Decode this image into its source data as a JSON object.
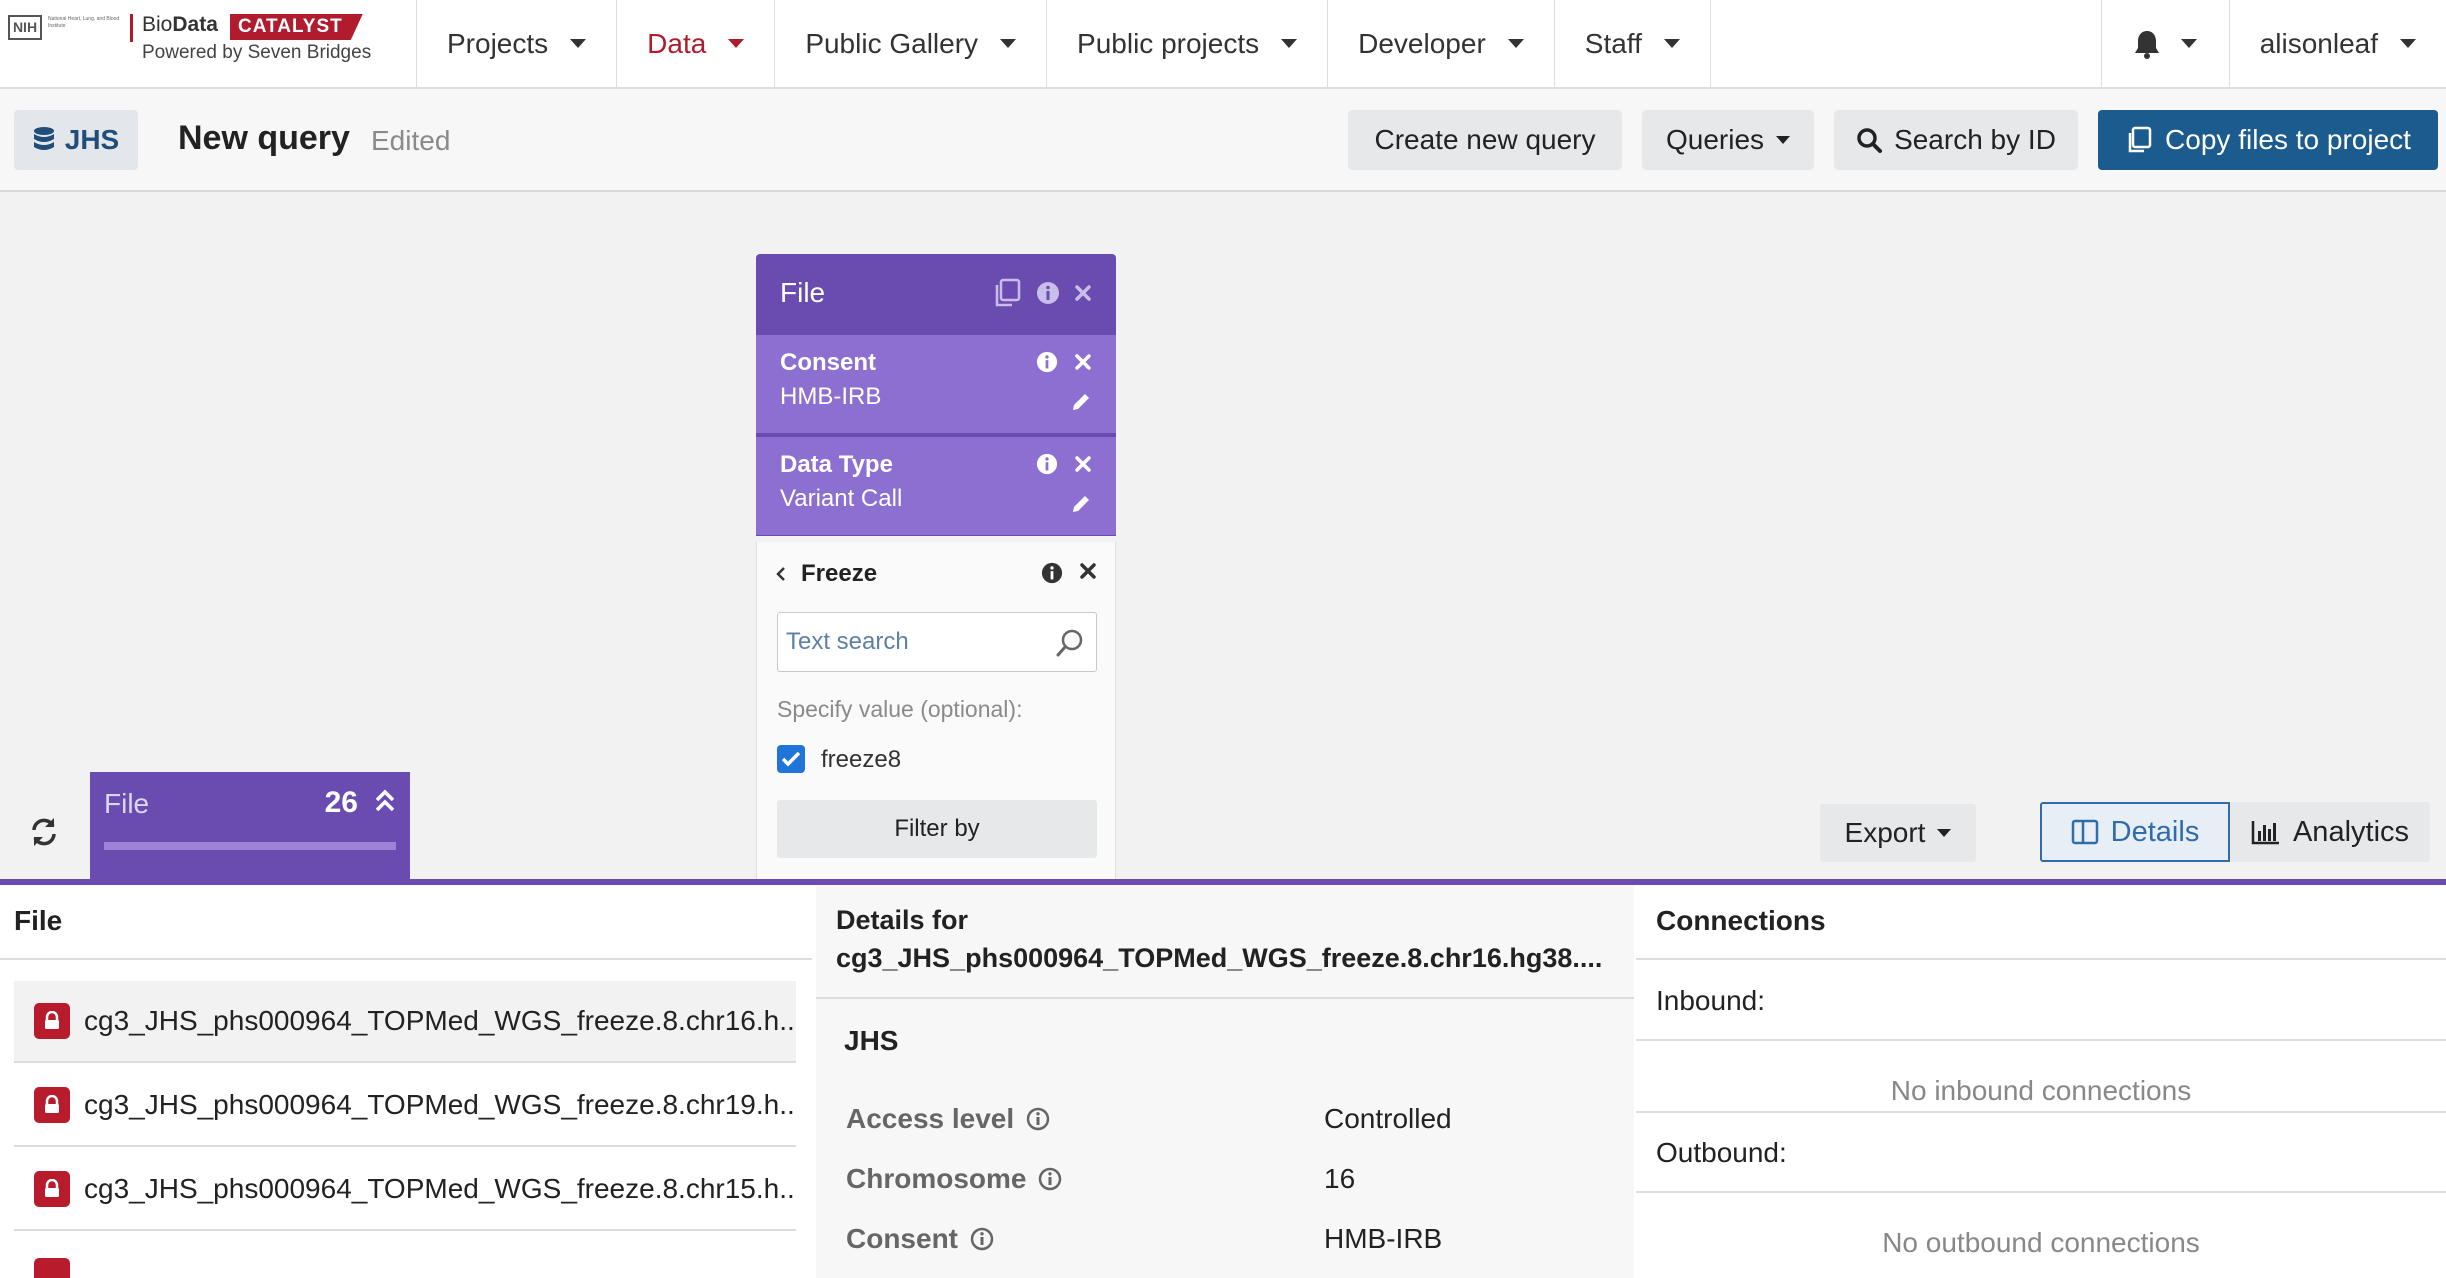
{
  "logo": {
    "nih": "NIH",
    "nih_text": "National Heart, Lung, and Blood Institute",
    "brand_prefix": "Bio",
    "brand_bold": "Data",
    "brand_tag": "CATALYST",
    "subtitle": "Powered by Seven Bridges"
  },
  "nav": {
    "items": [
      {
        "label": "Projects"
      },
      {
        "label": "Data"
      },
      {
        "label": "Public Gallery"
      },
      {
        "label": "Public projects"
      },
      {
        "label": "Developer"
      },
      {
        "label": "Staff"
      }
    ],
    "user": "alisonleaf"
  },
  "query_bar": {
    "dataset": "JHS",
    "title": "New query",
    "status": "Edited",
    "create_label": "Create new query",
    "queries_label": "Queries",
    "search_id_label": "Search by ID",
    "copy_label": "Copy files to project"
  },
  "node": {
    "title": "File",
    "filters": [
      {
        "name": "Consent",
        "value": "HMB-IRB"
      },
      {
        "name": "Data Type",
        "value": "Variant Call"
      }
    ]
  },
  "freeze_popup": {
    "title": "Freeze",
    "search_placeholder": "Text search",
    "specify_label": "Specify value (optional):",
    "option_label": "freeze8",
    "option_checked": true,
    "filter_button": "Filter by"
  },
  "file_tab": {
    "label": "File",
    "count": "26"
  },
  "toolbar": {
    "export_label": "Export",
    "details_label": "Details",
    "analytics_label": "Analytics"
  },
  "file_list": {
    "header": "File",
    "rows": [
      {
        "name": "cg3_JHS_phs000964_TOPMed_WGS_freeze.8.chr16.h..."
      },
      {
        "name": "cg3_JHS_phs000964_TOPMed_WGS_freeze.8.chr19.h..."
      },
      {
        "name": "cg3_JHS_phs000964_TOPMed_WGS_freeze.8.chr15.h..."
      }
    ]
  },
  "details": {
    "header_prefix": "Details for",
    "header_file": "cg3_JHS_phs000964_TOPMed_WGS_freeze.8.chr16.hg38....",
    "section": "JHS",
    "rows": [
      {
        "key": "Access level",
        "value": "Controlled"
      },
      {
        "key": "Chromosome",
        "value": "16"
      },
      {
        "key": "Consent",
        "value": "HMB-IRB"
      }
    ]
  },
  "connections": {
    "header": "Connections",
    "inbound_label": "Inbound:",
    "inbound_empty": "No inbound connections",
    "outbound_label": "Outbound:",
    "outbound_empty": "No outbound connections"
  },
  "colors": {
    "brand_red": "#b01c2e",
    "purple": "#6a4bb0",
    "purple_light": "#8c6fd0",
    "primary_blue": "#1c5b8e",
    "checkbox_blue": "#2175d9"
  }
}
